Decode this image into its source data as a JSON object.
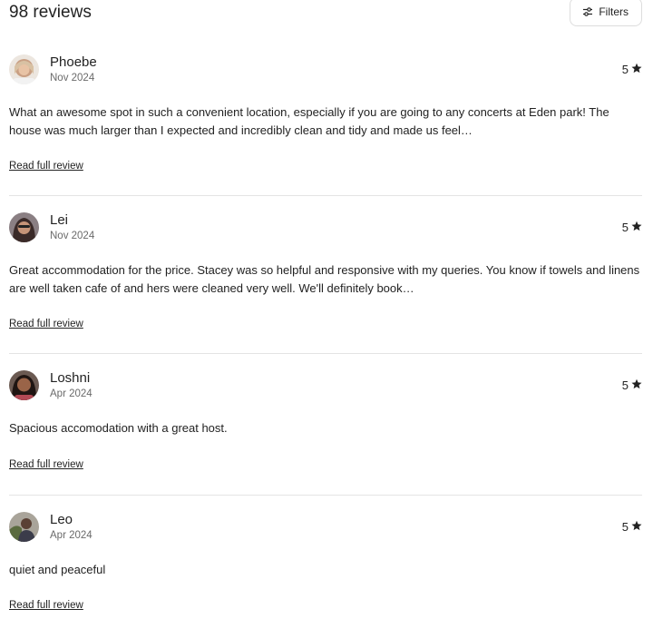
{
  "header": {
    "title": "98 reviews",
    "filters_label": "Filters",
    "filters_icon": "sliders-icon"
  },
  "reviews": [
    {
      "name": "Phoebe",
      "date": "Nov 2024",
      "rating": "5",
      "text": "What an awesome spot in such a convenient location, especially if you are going to any concerts at Eden park! The house was much larger than I expected and incredibly clean and tidy and made us feel…",
      "link": "Read full review"
    },
    {
      "name": "Lei",
      "date": "Nov 2024",
      "rating": "5",
      "text": "Great accommodation for the price. Stacey was so helpful and responsive with my queries. You know if towels and linens are well taken cafe of and hers were cleaned very well. We'll definitely book…",
      "link": "Read full review"
    },
    {
      "name": "Loshni",
      "date": "Apr 2024",
      "rating": "5",
      "text": "Spacious accomodation with a great host.",
      "link": "Read full review"
    },
    {
      "name": "Leo",
      "date": "Apr 2024",
      "rating": "5",
      "text": "quiet and peaceful",
      "link": "Read full review"
    }
  ],
  "colors": {
    "text": "#222222",
    "muted": "#6a6a6a",
    "divider": "#e4e4e4"
  }
}
